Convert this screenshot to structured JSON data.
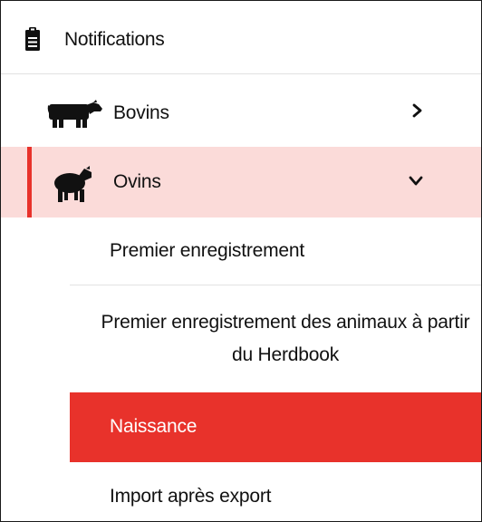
{
  "header": {
    "title": "Notifications",
    "icon": "clipboard-icon"
  },
  "menu": {
    "items": [
      {
        "label": "Bovins",
        "icon": "cow-icon",
        "expanded": false
      },
      {
        "label": "Ovins",
        "icon": "sheep-icon",
        "expanded": true
      }
    ],
    "ovins_submenu": [
      {
        "label": "Premier enregistrement",
        "active": false
      },
      {
        "label": "Premier enregistrement des animaux à partir du Herdbook",
        "active": false
      },
      {
        "label": "Naissance",
        "active": true
      },
      {
        "label": "Import après export",
        "active": false
      }
    ]
  },
  "colors": {
    "accent": "#e8322b",
    "selected_bg": "#fbdbd9",
    "divider": "#e2e2e2"
  }
}
